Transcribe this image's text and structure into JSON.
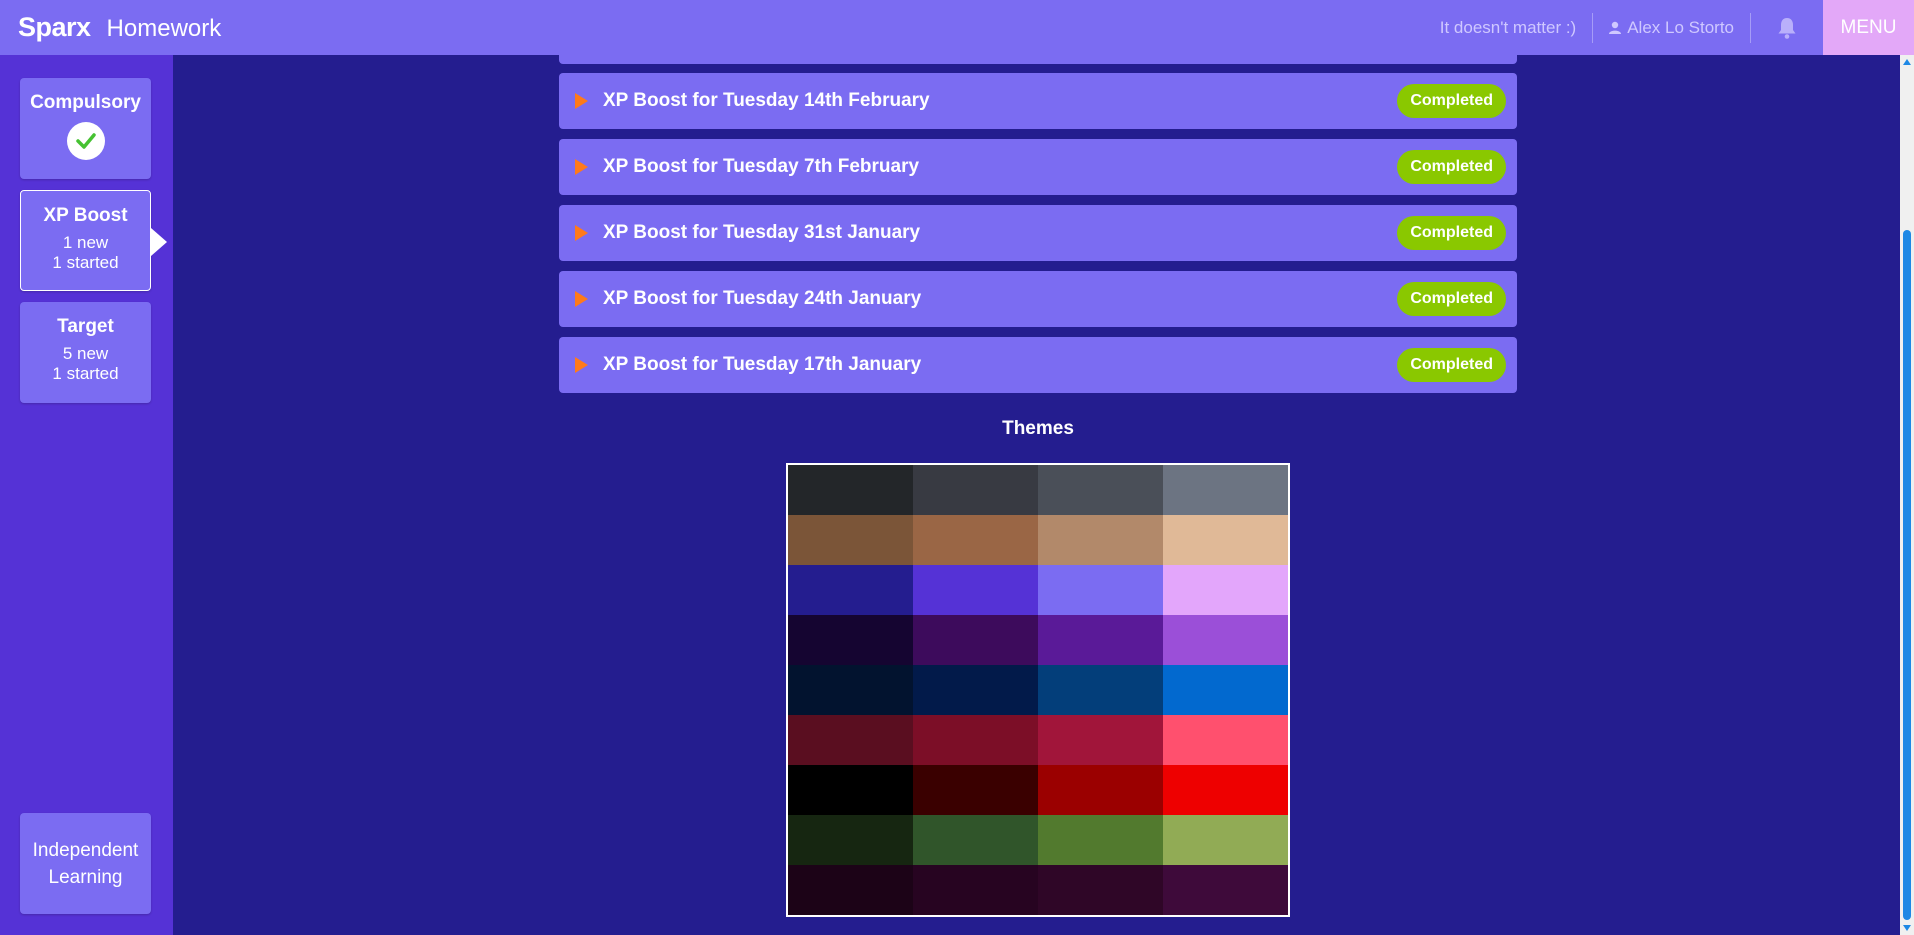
{
  "header": {
    "logo": "Sparx",
    "title": "Homework",
    "motto": "It doesn't matter :)",
    "user_name": "Alex Lo Storto",
    "menu_label": "MENU"
  },
  "sidebar": {
    "compulsory": {
      "title": "Compulsory"
    },
    "xp_boost": {
      "title": "XP Boost",
      "line1": "1 new",
      "line2": "1 started"
    },
    "target": {
      "title": "Target",
      "line1": "5 new",
      "line2": "1 started"
    },
    "independent": {
      "line1": "Independent",
      "line2": "Learning"
    }
  },
  "homework_list": [
    {
      "label": "XP Boost for Tuesday 14th February",
      "status": "Completed"
    },
    {
      "label": "XP Boost for Tuesday 7th February",
      "status": "Completed"
    },
    {
      "label": "XP Boost for Tuesday 31st January",
      "status": "Completed"
    },
    {
      "label": "XP Boost for Tuesday 24th January",
      "status": "Completed"
    },
    {
      "label": "XP Boost for Tuesday 17th January",
      "status": "Completed"
    }
  ],
  "themes": {
    "title": "Themes",
    "swatches": [
      "#232629",
      "#383a42",
      "#4a4f58",
      "#6c7482",
      "#7b5538",
      "#9a6645",
      "#b2896a",
      "#e0b997",
      "#241d8f",
      "#5532d6",
      "#7b6cf2",
      "#e3a6fb",
      "#150531",
      "#3d0b5c",
      "#5a1a98",
      "#9b4fd8",
      "#02132f",
      "#021a4a",
      "#033e7a",
      "#0269cf",
      "#5a0e20",
      "#7c0e27",
      "#a1153a",
      "#ff506e",
      "#000000",
      "#3a0000",
      "#9b0000",
      "#ee0000",
      "#162611",
      "#30552a",
      "#527a2e",
      "#91ab55",
      "#1c0317",
      "#270421",
      "#2f0627",
      "#3e0a3a"
    ]
  },
  "colors": {
    "topbar": "#7b6cf2",
    "sidebar": "#5532d6",
    "background": "#241d8f",
    "menu": "#e3a8f8",
    "completed": "#8ac800",
    "arrow": "#ff7a1a"
  }
}
